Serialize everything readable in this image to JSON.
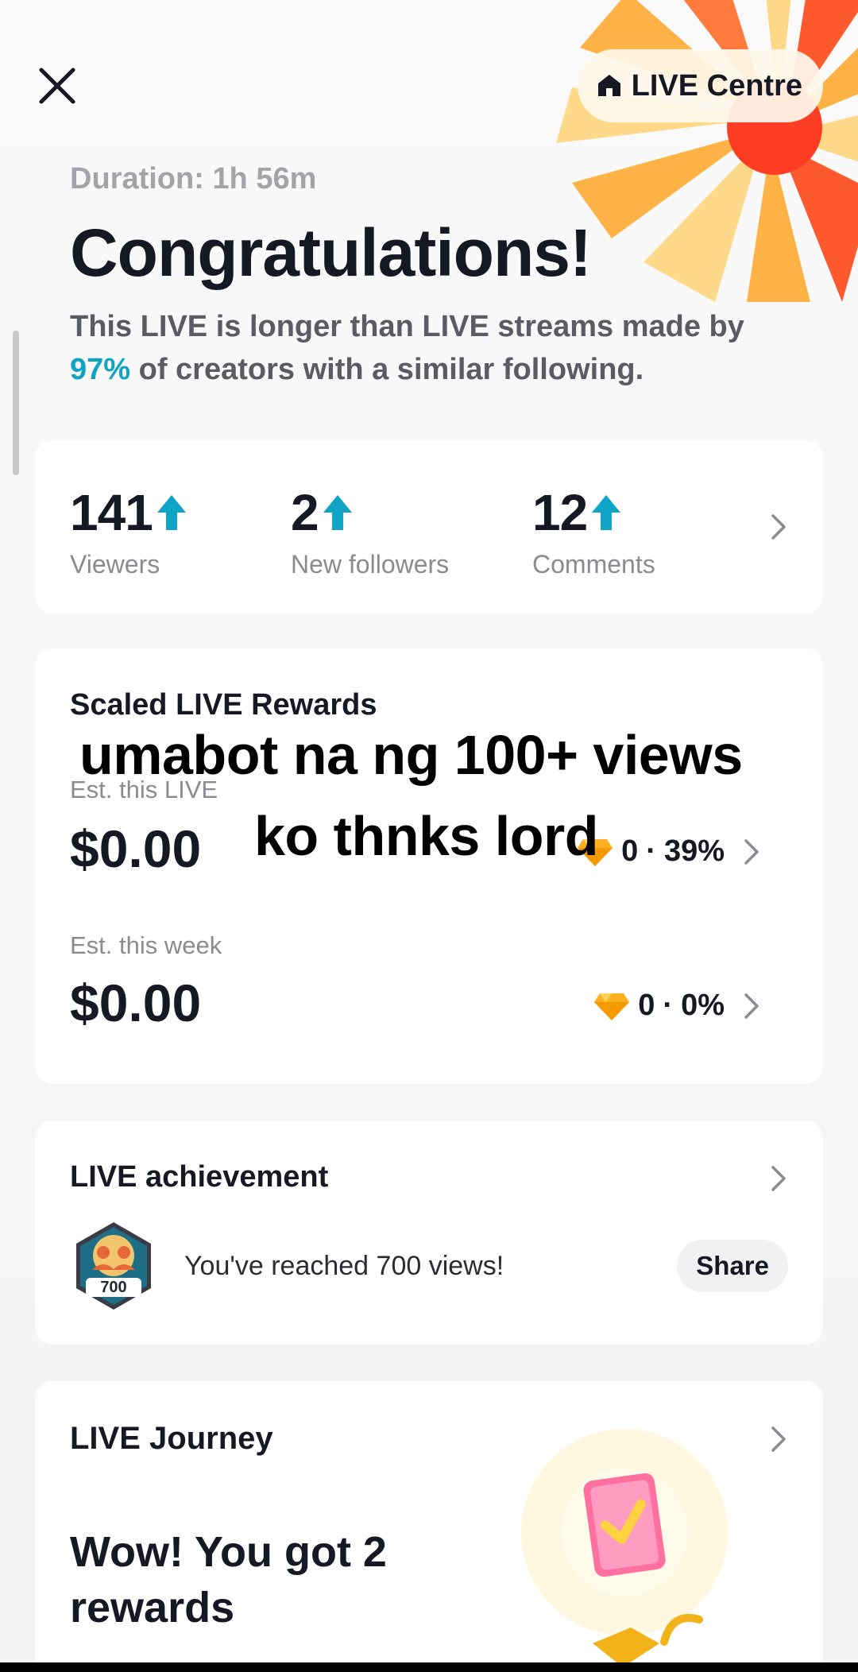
{
  "header": {
    "close_label": "close",
    "live_centre_label": "LIVE Centre"
  },
  "summary": {
    "duration": "Duration: 1h 56m",
    "title": "Congratulations!",
    "subtitle_pre": "This LIVE is longer than LIVE streams made by ",
    "subtitle_pct": "97%",
    "subtitle_post": " of creators with a similar following."
  },
  "stats": [
    {
      "value": "141",
      "label": "Viewers"
    },
    {
      "value": "2",
      "label": "New followers"
    },
    {
      "value": "12",
      "label": "Comments"
    }
  ],
  "rewards": {
    "title": "Scaled LIVE Rewards",
    "live_label": "Est. this LIVE",
    "live_amount": "$0.00",
    "live_gems": "0",
    "live_pct": "39%",
    "week_label": "Est. this week",
    "week_amount": "$0.00",
    "week_gems": "0",
    "week_pct": "0%",
    "separator": "·"
  },
  "overlay_caption": {
    "line1": "umabot na ng 100+ views",
    "line2": "ko thnks lord"
  },
  "achievement": {
    "title": "LIVE achievement",
    "badge_number": "700",
    "text": "You've reached 700 views!",
    "share_label": "Share"
  },
  "journey": {
    "title": "LIVE Journey",
    "headline": "Wow! You got 2 rewards"
  },
  "colors": {
    "accent": "#0fa3c5",
    "burst_orange": "#ffb347",
    "burst_red": "#ff4b2b",
    "gem_gold": "#ffb020"
  }
}
